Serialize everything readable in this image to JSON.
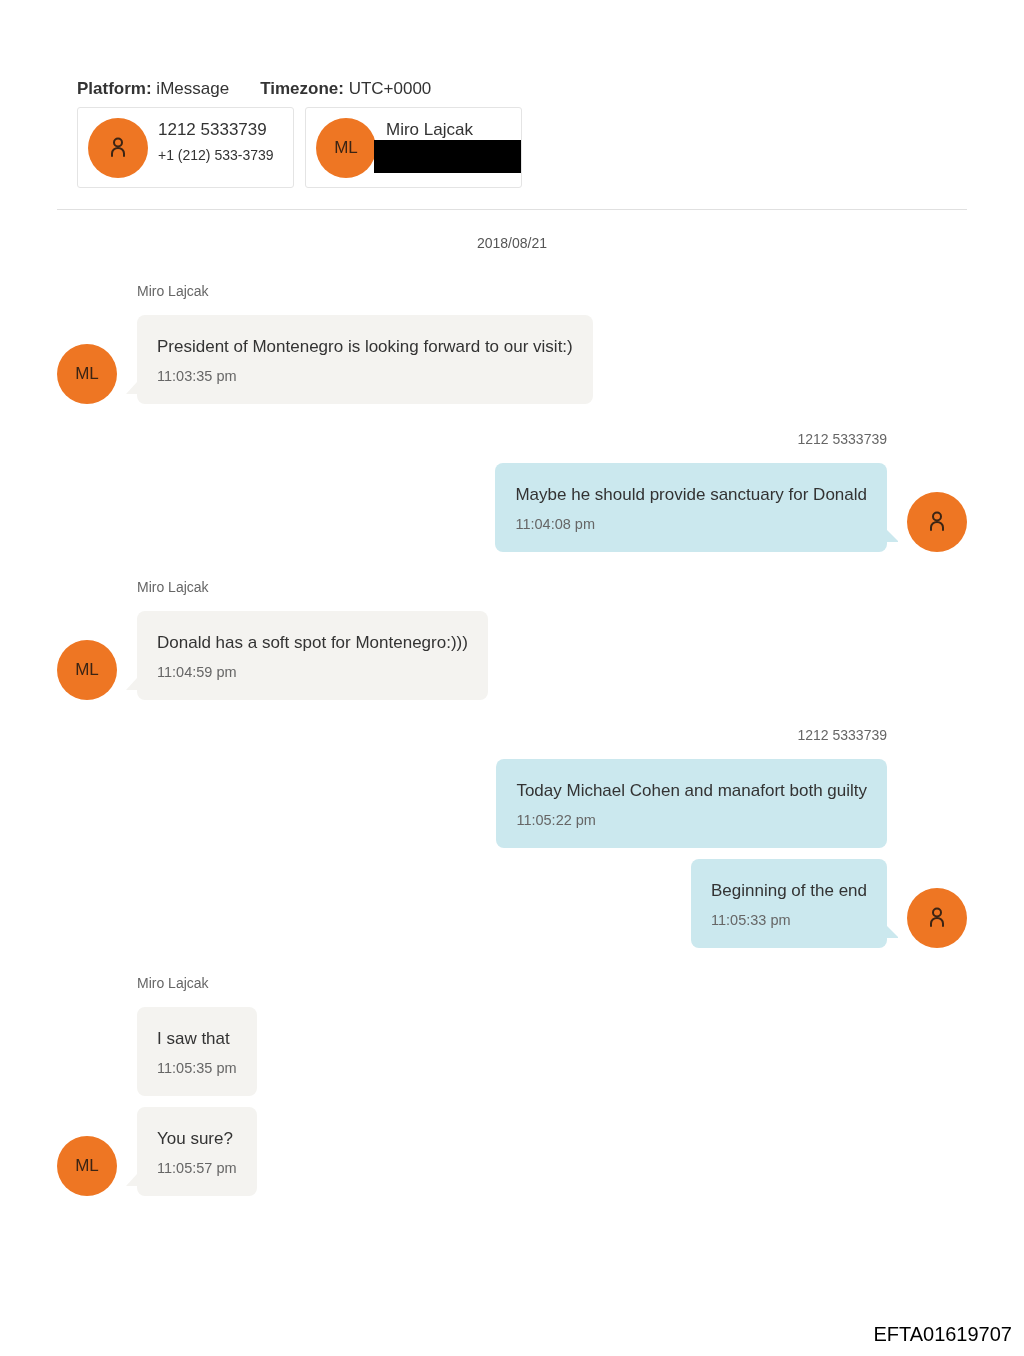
{
  "header": {
    "fields": [
      {
        "label": "Platform:",
        "value": "iMessage"
      },
      {
        "label": "Timezone:",
        "value": "UTC+0000"
      }
    ]
  },
  "participants": [
    {
      "name": "1212 5333739",
      "detail": "+1 (212) 533-3739",
      "redacted": false,
      "avatar": {
        "kind": "person"
      }
    },
    {
      "name": "Miro Lajcak",
      "redacted": true,
      "avatar": {
        "kind": "initials",
        "text": "ML"
      }
    }
  ],
  "conversation": {
    "date": "2018/08/21",
    "groups": [
      {
        "kind": "incoming",
        "sender": "Miro Lajcak",
        "avatar": {
          "kind": "initials",
          "text": "ML"
        },
        "messages": [
          {
            "text": "President of Montenegro is looking forward to our visit:)",
            "time": "11:03:35 pm"
          }
        ]
      },
      {
        "kind": "outgoing",
        "sender": "1212 5333739",
        "avatar": {
          "kind": "person"
        },
        "messages": [
          {
            "text": "Maybe he should provide sanctuary for Donald",
            "time": "11:04:08 pm"
          }
        ]
      },
      {
        "kind": "incoming",
        "sender": "Miro Lajcak",
        "avatar": {
          "kind": "initials",
          "text": "ML"
        },
        "messages": [
          {
            "text": "Donald has a soft spot for Montenegro:)))",
            "time": "11:04:59 pm"
          }
        ]
      },
      {
        "kind": "outgoing",
        "sender": "1212 5333739",
        "avatar": {
          "kind": "person"
        },
        "messages": [
          {
            "text": "Today Michael Cohen and manafort both guilty",
            "time": "11:05:22 pm"
          },
          {
            "text": "Beginning of the end",
            "time": "11:05:33 pm"
          }
        ]
      },
      {
        "kind": "incoming",
        "sender": "Miro Lajcak",
        "avatar": {
          "kind": "initials",
          "text": "ML"
        },
        "messages": [
          {
            "text": "I saw that",
            "time": "11:05:35 pm"
          },
          {
            "text": "You sure?",
            "time": "11:05:57 pm"
          }
        ]
      }
    ]
  },
  "document_id": "EFTA01619707"
}
